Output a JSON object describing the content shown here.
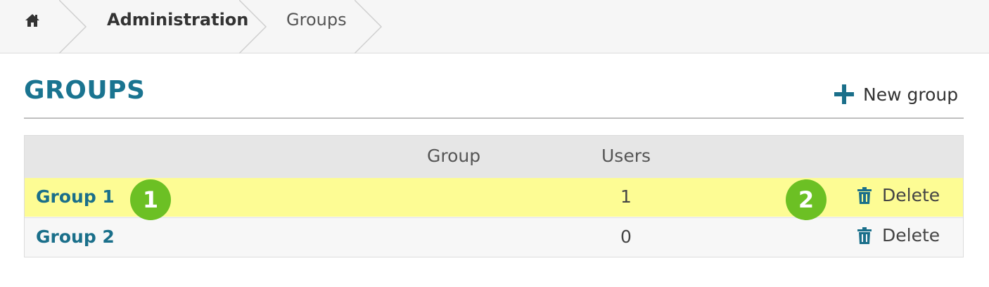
{
  "breadcrumb": {
    "home_icon": "home-icon",
    "items": [
      {
        "label": "Administration"
      },
      {
        "label": "Groups"
      }
    ]
  },
  "header": {
    "title": "GROUPS",
    "new_group_label": "New group",
    "new_group_icon": "plus-icon"
  },
  "table": {
    "columns": [
      "Group",
      "Users"
    ],
    "rows": [
      {
        "name": "Group 1",
        "users": "1",
        "delete_label": "Delete",
        "highlighted": true
      },
      {
        "name": "Group 2",
        "users": "0",
        "delete_label": "Delete",
        "highlighted": false
      }
    ],
    "delete_icon": "trash-icon"
  },
  "callouts": [
    {
      "label": "1"
    },
    {
      "label": "2"
    }
  ],
  "colors": {
    "accent": "#1a7490",
    "highlight_row": "#fdfc94",
    "callout": "#6cc024"
  }
}
